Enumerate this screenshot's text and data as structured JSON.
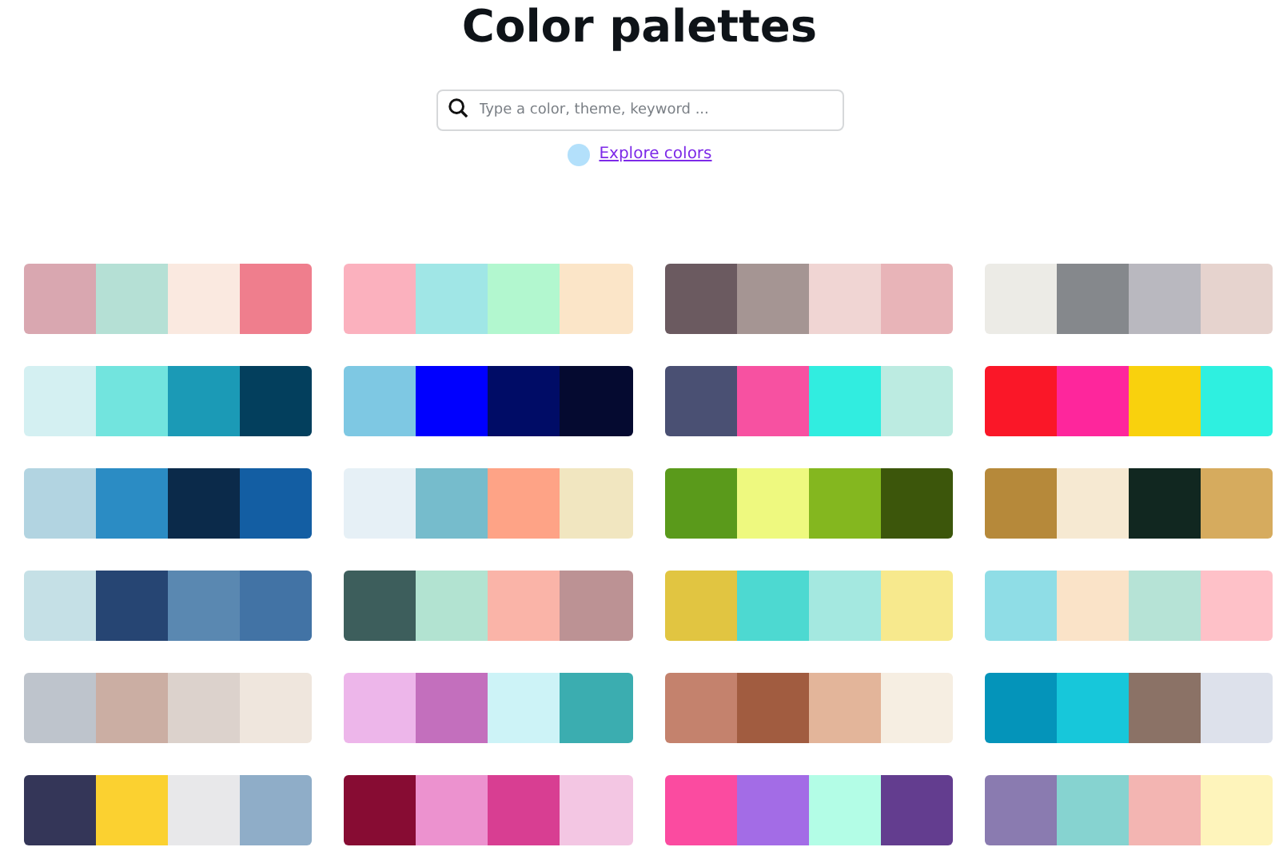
{
  "title": "Color palettes",
  "search": {
    "placeholder": "Type a color, theme, keyword ..."
  },
  "explore": {
    "label": "Explore colors",
    "color": "#b3e0fb"
  },
  "palettes": [
    {
      "swatches": [
        {
          "color": "#d9a7b0"
        },
        {
          "color": "#b5e0d5"
        },
        {
          "color": "#fae9e0"
        },
        {
          "color": "#ef7e8d"
        }
      ]
    },
    {
      "swatches": [
        {
          "color": "#fbb1be"
        },
        {
          "color": "#a0e6e6"
        },
        {
          "color": "#b2f7cf"
        },
        {
          "color": "#fbe5c8"
        }
      ]
    },
    {
      "swatches": [
        {
          "color": "#6b5a60"
        },
        {
          "color": "#a59593"
        },
        {
          "color": "#f0d5d3"
        },
        {
          "color": "#e8b4b8"
        }
      ]
    },
    {
      "swatches": [
        {
          "color": "#ecebe6"
        },
        {
          "color": "#85888c"
        },
        {
          "color": "#b9b8bf"
        },
        {
          "color": "#e6d3ce"
        }
      ]
    },
    {
      "swatches": [
        {
          "color": "#d4f0f2"
        },
        {
          "color": "#72e4de"
        },
        {
          "color": "#1b9ab6"
        },
        {
          "color": "#033f5d"
        }
      ]
    },
    {
      "swatches": [
        {
          "color": "#7ec8e3"
        },
        {
          "color": "#0000ff"
        },
        {
          "color": "#000c66"
        },
        {
          "color": "#050a30"
        }
      ]
    },
    {
      "swatches": [
        {
          "color": "#4a5073"
        },
        {
          "color": "#f751a1"
        },
        {
          "color": "#31ede0"
        },
        {
          "color": "#bcebe1"
        }
      ]
    },
    {
      "swatches": [
        {
          "color": "#fa1728"
        },
        {
          "color": "#fe269c"
        },
        {
          "color": "#f9d10d"
        },
        {
          "color": "#2ef0e0"
        }
      ]
    },
    {
      "swatches": [
        {
          "color": "#b2d4e1"
        },
        {
          "color": "#2b8cc4"
        },
        {
          "color": "#0b2a4a"
        },
        {
          "color": "#135ea3"
        }
      ]
    },
    {
      "swatches": [
        {
          "color": "#e6f0f6"
        },
        {
          "color": "#76bccc"
        },
        {
          "color": "#fea386"
        },
        {
          "color": "#f1e6c0"
        }
      ]
    },
    {
      "swatches": [
        {
          "color": "#5a9a1b"
        },
        {
          "color": "#eef97f"
        },
        {
          "color": "#84b71f"
        },
        {
          "color": "#3c560b"
        }
      ]
    },
    {
      "swatches": [
        {
          "color": "#b6893a"
        },
        {
          "color": "#f6e9d2"
        },
        {
          "color": "#112720"
        },
        {
          "color": "#d6ab5e"
        }
      ]
    },
    {
      "swatches": [
        {
          "color": "#c5e0e6"
        },
        {
          "color": "#264573"
        },
        {
          "color": "#5a88b1"
        },
        {
          "color": "#4273a5"
        }
      ]
    },
    {
      "swatches": [
        {
          "color": "#3d5e5c"
        },
        {
          "color": "#b2e3d1"
        },
        {
          "color": "#fab4a8"
        },
        {
          "color": "#bc9294"
        }
      ]
    },
    {
      "swatches": [
        {
          "color": "#e1c541"
        },
        {
          "color": "#4dd9d1"
        },
        {
          "color": "#a4e8e0"
        },
        {
          "color": "#f7e98d"
        }
      ]
    },
    {
      "swatches": [
        {
          "color": "#8fdde6"
        },
        {
          "color": "#fae3c8"
        },
        {
          "color": "#b6e3d6"
        },
        {
          "color": "#fec1c8"
        }
      ]
    },
    {
      "swatches": [
        {
          "color": "#bec4cc"
        },
        {
          "color": "#cbaea3"
        },
        {
          "color": "#dcd2cc"
        },
        {
          "color": "#efe6dd"
        }
      ]
    },
    {
      "swatches": [
        {
          "color": "#edb6ea"
        },
        {
          "color": "#c36fbd"
        },
        {
          "color": "#cdf3f7"
        },
        {
          "color": "#3badb0"
        }
      ]
    },
    {
      "swatches": [
        {
          "color": "#c4826d"
        },
        {
          "color": "#a15c40"
        },
        {
          "color": "#e3b59a"
        },
        {
          "color": "#f6eee2"
        }
      ]
    },
    {
      "swatches": [
        {
          "color": "#0494ba"
        },
        {
          "color": "#17c7da"
        },
        {
          "color": "#8b7266"
        },
        {
          "color": "#dde1eb"
        }
      ]
    },
    {
      "swatches": [
        {
          "color": "#343658"
        },
        {
          "color": "#fbd130"
        },
        {
          "color": "#e8e8ea"
        },
        {
          "color": "#8fadc8"
        }
      ]
    },
    {
      "swatches": [
        {
          "color": "#870c33"
        },
        {
          "color": "#ec92cf"
        },
        {
          "color": "#d83e92"
        },
        {
          "color": "#f3c6e3"
        }
      ]
    },
    {
      "swatches": [
        {
          "color": "#fb4ba0"
        },
        {
          "color": "#a36ce6"
        },
        {
          "color": "#b3fde6"
        },
        {
          "color": "#633d8f"
        }
      ]
    },
    {
      "swatches": [
        {
          "color": "#8a7bb0"
        },
        {
          "color": "#86d3d0"
        },
        {
          "color": "#f3b5b2"
        },
        {
          "color": "#fef4bb"
        }
      ]
    }
  ]
}
